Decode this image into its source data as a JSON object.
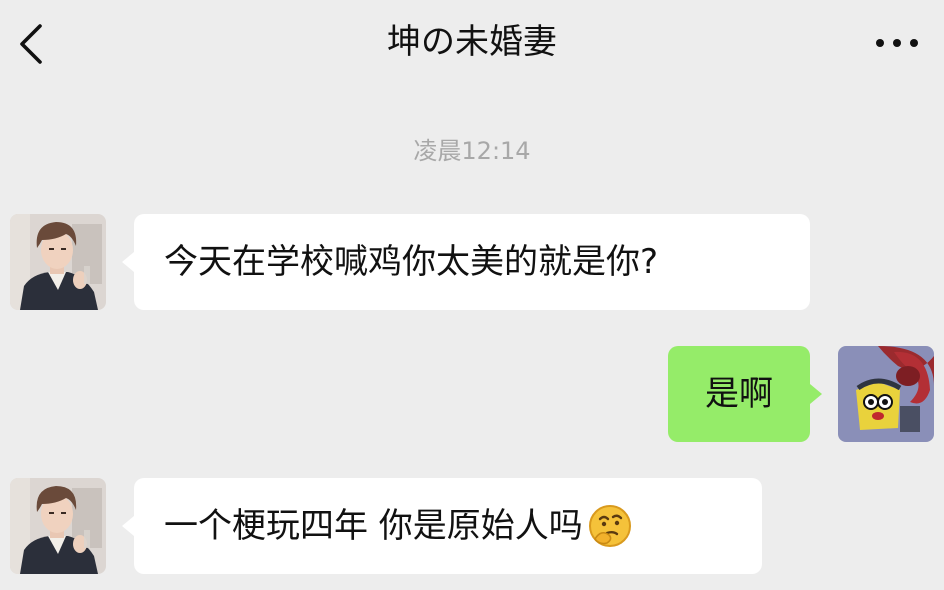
{
  "header": {
    "title": "坤の未婚妻",
    "back_icon": "chevron-left-icon",
    "more_icon": "more-dots-icon"
  },
  "timestamp": "凌晨12:14",
  "messages": [
    {
      "sender": "contact",
      "text": "今天在学校喊鸡你太美的就是你?"
    },
    {
      "sender": "me",
      "text": "是啊"
    },
    {
      "sender": "contact",
      "text": "一个梗玩四年 你是原始人吗",
      "emoji": "thinking-face-icon"
    }
  ],
  "colors": {
    "background": "#ededed",
    "incoming_bubble": "#ffffff",
    "outgoing_bubble": "#95ec69"
  }
}
